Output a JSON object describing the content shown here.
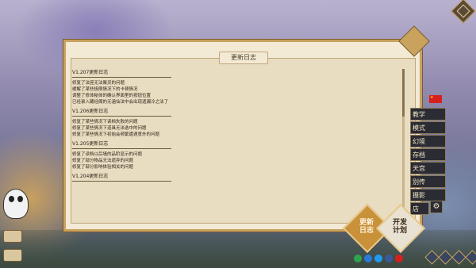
{
  "background": {
    "calligraphy": ""
  },
  "dialog": {
    "title": "更新日志",
    "entries": [
      {
        "version": "V1.207更新日志",
        "lines": [
          "修复了法座无法聚灵的问题",
          "缓解了某些极限情况下的卡顿情况",
          "调整了修体秘体的确认界面里的按钮位置",
          "已经录入藏经阁的无涵仙法中会出现遗漏冷之法了"
        ]
      },
      {
        "version": "V1.206更新日志",
        "lines": [
          "修复了某些情况下读档失败的问题",
          "修复了某些情况下道具无法选中的问题",
          "修复了某些情况下初始会频繁遭遇意外的问题"
        ]
      },
      {
        "version": "V1.205更新日志",
        "lines": [
          "修复了读档以后墙的品阶显示的问题",
          "修复了部分物品无法遗弃的问题",
          "修复了部分影响体验相关的问题"
        ]
      },
      {
        "version": "V1.204更新日志",
        "lines": []
      }
    ]
  },
  "menu": {
    "items": [
      "教学",
      "模式",
      "幻境",
      "存档",
      "天宫",
      "别传",
      "摄影",
      "店"
    ],
    "settings_icon": "gear-icon"
  },
  "buttons": {
    "update_log": "更新\n日志",
    "dev_plan": "开发\n计划"
  },
  "flag": {
    "icon": "china-flag-icon",
    "color": "#d62020"
  },
  "colors": {
    "panel": "#f3ead6",
    "border": "#c9a25e",
    "menu_bg": "#2b2b33",
    "accent": "#c8913a"
  }
}
